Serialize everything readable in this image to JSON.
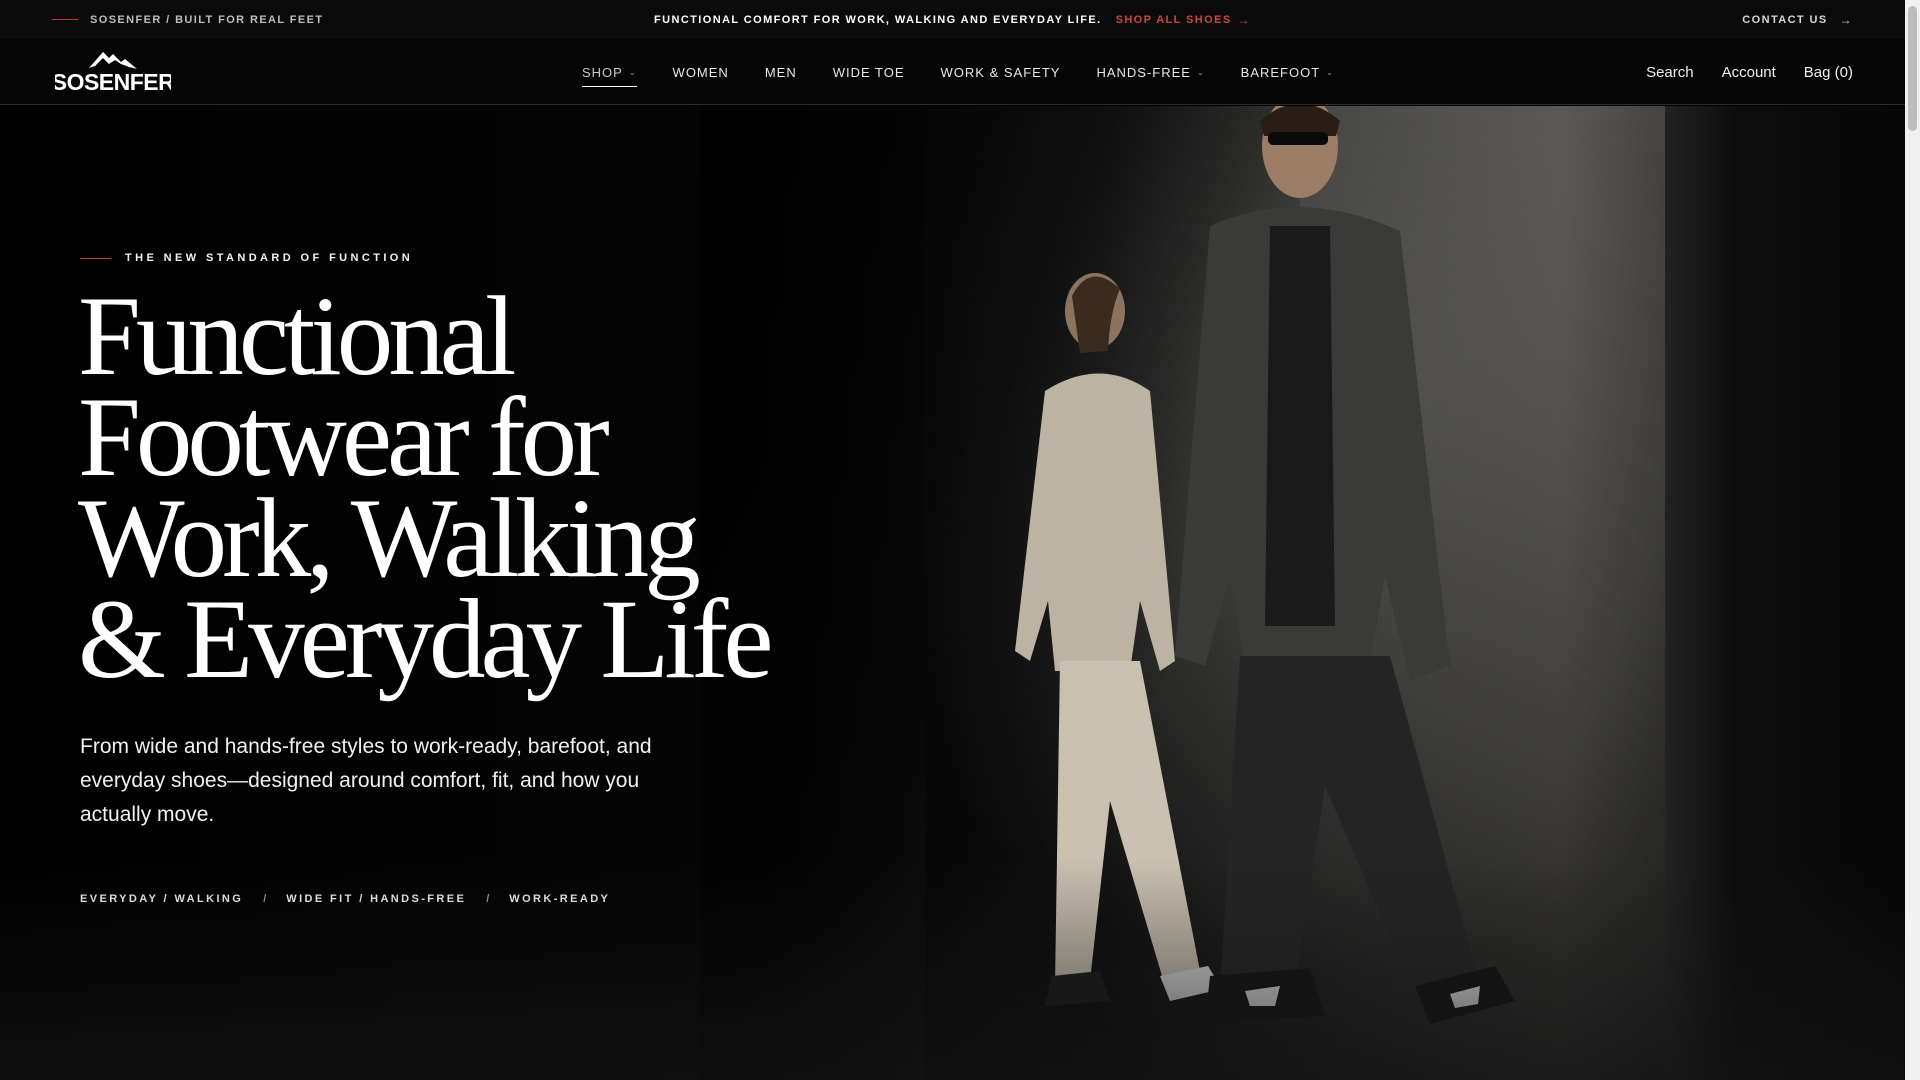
{
  "announcement": {
    "left_text": "SOSENFER / BUILT FOR REAL FEET",
    "message": "FUNCTIONAL COMFORT FOR WORK, WALKING AND EVERYDAY LIFE.",
    "cta_label": "SHOP ALL SHOES",
    "contact_label": "CONTACT US"
  },
  "header": {
    "logo_text": "SOSENFER",
    "nav": [
      {
        "label": "SHOP",
        "has_dropdown": true,
        "active": true
      },
      {
        "label": "WOMEN",
        "has_dropdown": false
      },
      {
        "label": "MEN",
        "has_dropdown": false
      },
      {
        "label": "WIDE TOE",
        "has_dropdown": false
      },
      {
        "label": "WORK & SAFETY",
        "has_dropdown": false
      },
      {
        "label": "HANDS-FREE",
        "has_dropdown": true
      },
      {
        "label": "BAREFOOT",
        "has_dropdown": true
      }
    ],
    "search_label": "Search",
    "account_label": "Account",
    "bag_label": "Bag (0)"
  },
  "hero": {
    "eyebrow": "THE NEW STANDARD OF FUNCTION",
    "headline_lines": [
      "Functional",
      "Footwear for",
      "Work, Walking",
      "& Everyday Life"
    ],
    "subtext": "From wide and hands-free styles to work-ready, barefoot, and everyday shoes—designed around comfort, fit, and how you actually move.",
    "tags": [
      "EVERYDAY / WALKING",
      "WIDE FIT / HANDS-FREE",
      "WORK-READY"
    ],
    "tag_separator": "/"
  },
  "colors": {
    "accent_red": "#c53a2e",
    "cta_red": "#c9493a",
    "header_bg": "#050505",
    "topbar_bg": "#0b0b0b"
  },
  "icons": [
    "arrow-right-icon",
    "chevron-down-icon",
    "mountain-logo-icon"
  ]
}
